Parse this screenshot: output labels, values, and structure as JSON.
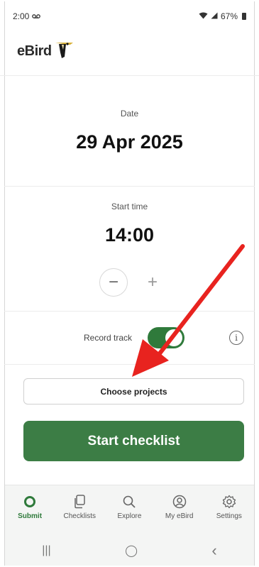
{
  "status_bar": {
    "time": "2:00",
    "voicemail_icon": "voicemail-icon",
    "battery_text": "67%"
  },
  "header": {
    "logo_text": "eBird"
  },
  "date": {
    "label": "Date",
    "value": "29 Apr 2025"
  },
  "start_time": {
    "label": "Start time",
    "value": "14:00",
    "decrement_symbol": "−",
    "increment_symbol": "+"
  },
  "record_track": {
    "label": "Record track",
    "enabled": true,
    "info_symbol": "i"
  },
  "buttons": {
    "choose_projects": "Choose projects",
    "start_checklist": "Start checklist"
  },
  "bottom_nav": {
    "items": [
      {
        "label": "Submit",
        "icon": "submit-icon",
        "active": true
      },
      {
        "label": "Checklists",
        "icon": "checklists-icon",
        "active": false
      },
      {
        "label": "Explore",
        "icon": "search-icon",
        "active": false
      },
      {
        "label": "My eBird",
        "icon": "profile-icon",
        "active": false
      },
      {
        "label": "Settings",
        "icon": "gear-icon",
        "active": false
      }
    ]
  },
  "system_nav": {
    "recents_symbol": "|||",
    "home_symbol": "◯",
    "back_symbol": "‹"
  },
  "colors": {
    "accent_green": "#3c7d45",
    "arrow_red": "#e8231f"
  }
}
